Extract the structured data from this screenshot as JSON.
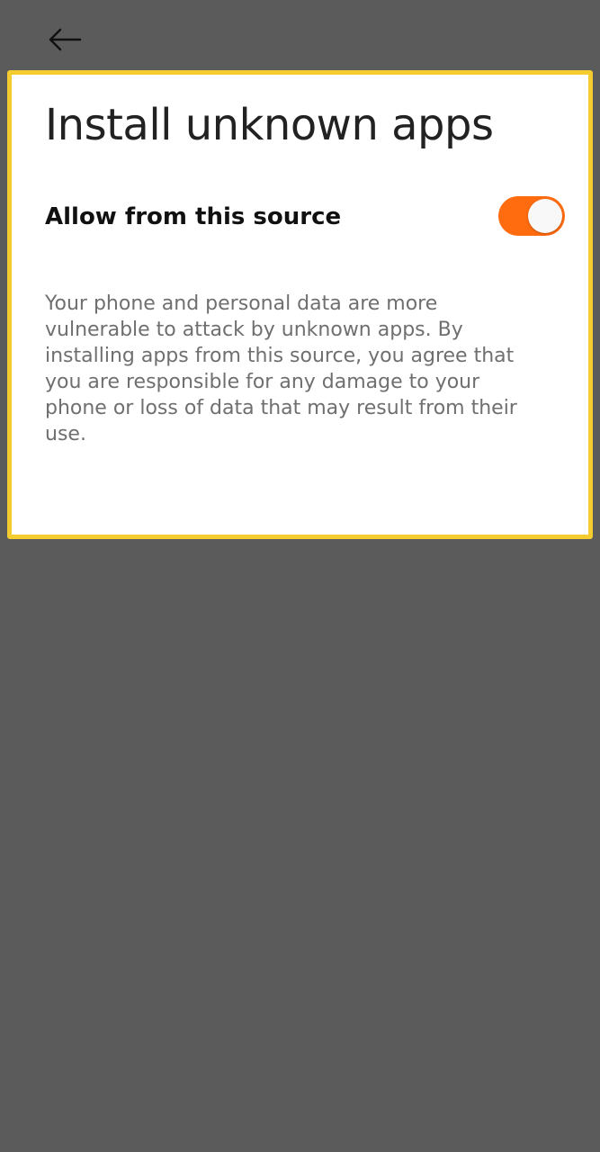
{
  "nav": {
    "back_icon": "arrow-left-icon"
  },
  "page": {
    "title": "Install unknown apps"
  },
  "setting": {
    "label": "Allow from this source",
    "enabled": true,
    "toggle_color": "#ff6b0f"
  },
  "description": "Your phone and personal data are more vulnerable to attack by unknown apps. By installing apps from this source, you agree that you are responsible for any damage to your phone or loss of data that may result from their use.",
  "colors": {
    "background": "#5b5b5b",
    "highlight_border": "#f5cc2f"
  }
}
